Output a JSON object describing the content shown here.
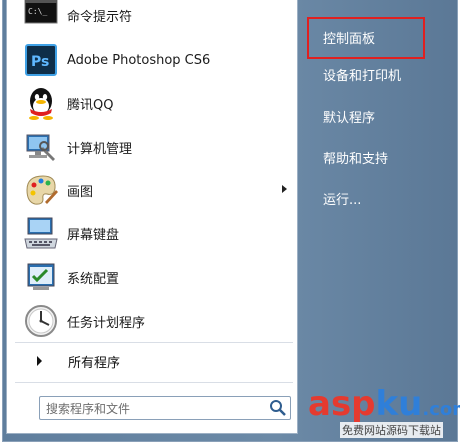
{
  "left_items": [
    {
      "label": "命令提示符",
      "icon": "cmd-icon"
    },
    {
      "label": "Adobe Photoshop CS6",
      "icon": "photoshop-icon"
    },
    {
      "label": "腾讯QQ",
      "icon": "qq-icon"
    },
    {
      "label": "计算机管理",
      "icon": "computer-management-icon"
    },
    {
      "label": "画图",
      "icon": "paint-icon"
    },
    {
      "label": "屏幕键盘",
      "icon": "keyboard-icon"
    },
    {
      "label": "系统配置",
      "icon": "system-config-icon"
    },
    {
      "label": "任务计划程序",
      "icon": "task-scheduler-icon"
    }
  ],
  "all_programs": "所有程序",
  "search": {
    "placeholder": "搜索程序和文件"
  },
  "right_items": [
    {
      "label": "控制面板"
    },
    {
      "label": "设备和打印机"
    },
    {
      "label": "默认程序"
    },
    {
      "label": "帮助和支持"
    },
    {
      "label": "运行..."
    }
  ],
  "watermark": {
    "main_a": "asp",
    "main_b": "ku",
    "main_c": ".com",
    "sub": "免费网站源码下载站"
  },
  "colors": {
    "highlight": "#e02020",
    "watermark_red": "#e53a2f",
    "watermark_blue": "#2f7fd9"
  }
}
